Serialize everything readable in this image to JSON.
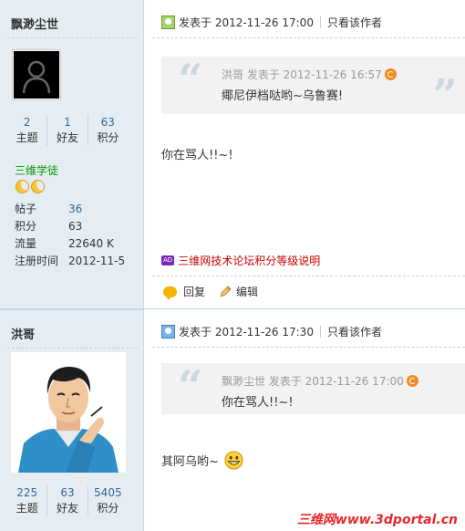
{
  "posts": [
    {
      "author": "飘渺尘世",
      "stats": [
        {
          "num": "2",
          "label": "主题"
        },
        {
          "num": "1",
          "label": "好友"
        },
        {
          "num": "63",
          "label": "积分"
        }
      ],
      "rank": "三维学徒",
      "info": [
        {
          "key": "帖子",
          "value": "36"
        },
        {
          "key": "积分",
          "value": "63"
        },
        {
          "key": "流量",
          "value": "22640 K"
        },
        {
          "key": "注册时间",
          "value": "2012-11-5"
        }
      ],
      "posted": "发表于 2012-11-26 17:00",
      "only_author": "只看该作者",
      "quote_meta": "洪哥  发表于 2012-11-26 16:57",
      "quote_text": "鄊尼伊档哒哟~乌鲁赛!",
      "body": "你在骂人!!~!",
      "ad_badge": "AD",
      "ad_text": "三维网技术论坛积分等级说明",
      "reply_label": "回复",
      "edit_label": "编辑"
    },
    {
      "author": "洪哥",
      "stats": [
        {
          "num": "225",
          "label": "主题"
        },
        {
          "num": "63",
          "label": "好友"
        },
        {
          "num": "5405",
          "label": "积分"
        }
      ],
      "posted": "发表于 2012-11-26 17:30",
      "only_author": "只看该作者",
      "quote_meta": "飘渺尘世  发表于 2012-11-26 17:00",
      "quote_text": "你在骂人!!~!",
      "body": "其阿乌哟~"
    }
  ],
  "watermark": "三维网www.3dportal.cn",
  "colors": {
    "sidebar_bg": "#e5edf2",
    "link": "#336699",
    "rank": "#009900",
    "ad": "#cc0000"
  }
}
